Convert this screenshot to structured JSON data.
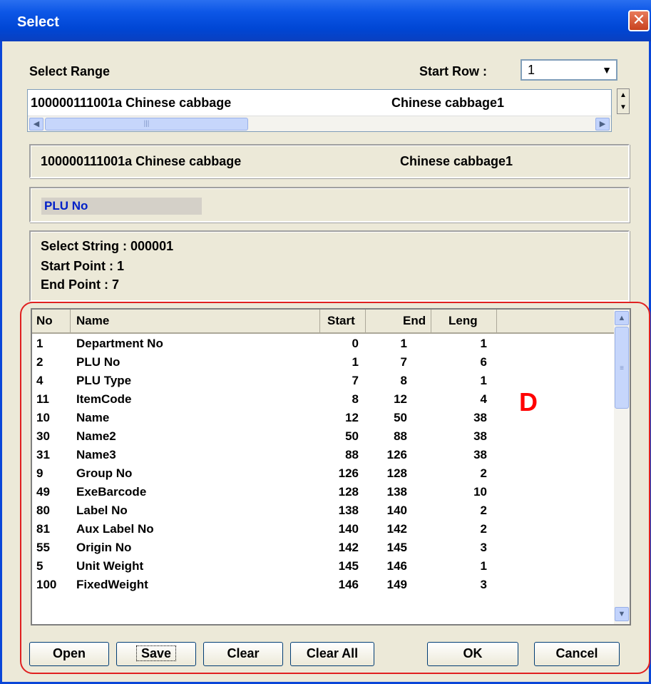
{
  "window": {
    "title": "Select",
    "close_glyph": "✕"
  },
  "select_range": {
    "label": "Select Range",
    "start_row_label": "Start Row :",
    "start_row_value": "1",
    "list_item_code": "100000111001a Chinese cabbage",
    "list_item_name": "Chinese cabbage1"
  },
  "preview": {
    "code": "100000111001a Chinese cabbage",
    "name": "Chinese cabbage1"
  },
  "field": {
    "selected": "PLU No"
  },
  "info": {
    "select_string": "Select String : 000001",
    "start_point": "Start Point : 1",
    "end_point": "End Point  : 7"
  },
  "table": {
    "columns": [
      "No",
      "Name",
      "Start",
      "End",
      "Leng"
    ],
    "rows": [
      [
        "1",
        "Department No",
        "0",
        "1",
        "1"
      ],
      [
        "2",
        "PLU No",
        "1",
        "7",
        "6"
      ],
      [
        "4",
        "PLU Type",
        "7",
        "8",
        "1"
      ],
      [
        "11",
        "ItemCode",
        "8",
        "12",
        "4"
      ],
      [
        "10",
        "Name",
        "12",
        "50",
        "38"
      ],
      [
        "30",
        "Name2",
        "50",
        "88",
        "38"
      ],
      [
        "31",
        "Name3",
        "88",
        "126",
        "38"
      ],
      [
        "9",
        "Group No",
        "126",
        "128",
        "2"
      ],
      [
        "49",
        "ExeBarcode",
        "128",
        "138",
        "10"
      ],
      [
        "80",
        "Label No",
        "138",
        "140",
        "2"
      ],
      [
        "81",
        "Aux Label No",
        "140",
        "142",
        "2"
      ],
      [
        "55",
        "Origin No",
        "142",
        "145",
        "3"
      ],
      [
        "5",
        "Unit Weight",
        "145",
        "146",
        "1"
      ],
      [
        "100",
        "FixedWeight",
        "146",
        "149",
        "3"
      ]
    ]
  },
  "marker": "D",
  "buttons": {
    "open": "Open",
    "save": "Save",
    "clear": "Clear",
    "clear_all": "Clear All",
    "ok": "OK",
    "cancel": "Cancel"
  },
  "icons": {
    "close": "close-icon",
    "dropdown": "chevron-down-icon",
    "scroll_left": "arrow-left-icon",
    "scroll_right": "arrow-right-icon",
    "scroll_up": "arrow-up-icon",
    "scroll_down": "arrow-down-icon"
  },
  "colors": {
    "title_bar": "#0a46d8",
    "highlight_outline": "#e02020",
    "field_text": "#0020c8",
    "marker": "#ff0000"
  }
}
